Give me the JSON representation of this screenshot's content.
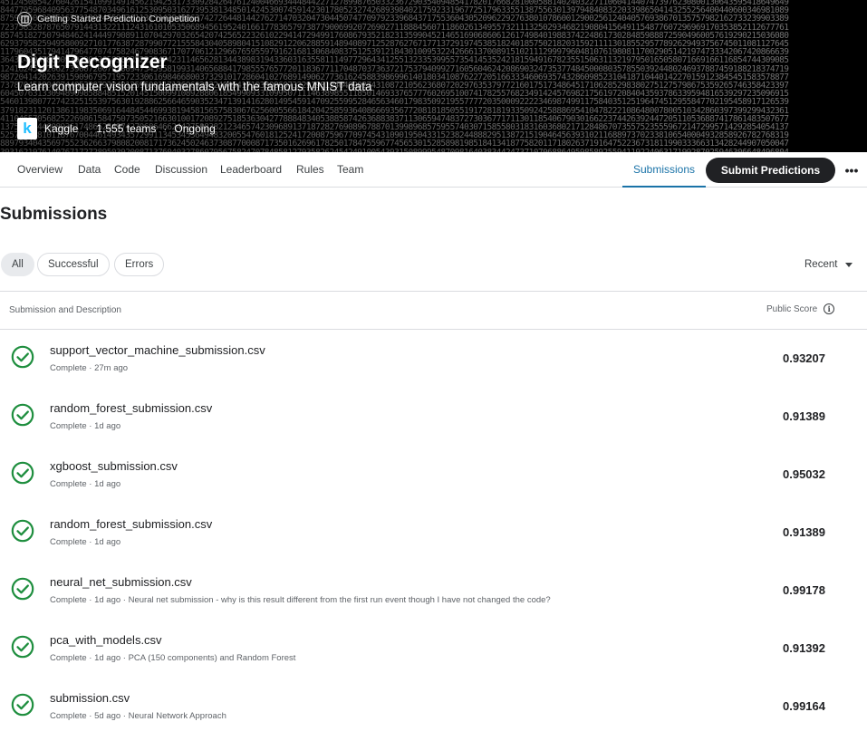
{
  "competition": {
    "type_label": "Getting Started Prediction Competition",
    "title": "Digit Recognizer",
    "subtitle": "Learn computer vision fundamentals with the famous MNIST data",
    "host": "Kaggle",
    "teams": "1,555 teams",
    "status": "Ongoing",
    "logo_letter": "k"
  },
  "tabs": [
    {
      "label": "Overview"
    },
    {
      "label": "Data"
    },
    {
      "label": "Code"
    },
    {
      "label": "Discussion"
    },
    {
      "label": "Leaderboard"
    },
    {
      "label": "Rules"
    },
    {
      "label": "Team"
    },
    {
      "label": "Submissions"
    }
  ],
  "submit_label": "Submit Predictions",
  "more_label": "•••",
  "page_title": "Submissions",
  "filters": [
    {
      "label": "All"
    },
    {
      "label": "Successful"
    },
    {
      "label": "Errors"
    }
  ],
  "sort_label": "Recent",
  "table": {
    "col_left": "Submission and Description",
    "col_right": "Public Score",
    "info_glyph": "i"
  },
  "submissions": [
    {
      "file": "support_vector_machine_submission.csv",
      "meta": "Complete · 27m ago",
      "score": "0.93207"
    },
    {
      "file": "random_forest_submission.csv",
      "meta": "Complete · 1d ago",
      "score": "0.91389"
    },
    {
      "file": "xgboost_submission.csv",
      "meta": "Complete · 1d ago",
      "score": "0.95032"
    },
    {
      "file": "random_forest_submission.csv",
      "meta": "Complete · 1d ago",
      "score": "0.91389"
    },
    {
      "file": "neural_net_submission.csv",
      "meta": "Complete · 1d ago · Neural net submission - why is this result different from the first run event though I have not changed the code?",
      "score": "0.99178"
    },
    {
      "file": "pca_with_models.csv",
      "meta": "Complete · 1d ago · PCA (150 components) and Random Forest",
      "score": "0.91392"
    },
    {
      "file": "submission.csv",
      "meta": "Complete · 5d ago · Neural Network Approach",
      "score": "0.99164"
    }
  ],
  "colors": {
    "accent": "#1a73a8",
    "success": "#1e8e3e",
    "button_dark": "#202124",
    "kaggle_blue": "#20beff"
  }
}
